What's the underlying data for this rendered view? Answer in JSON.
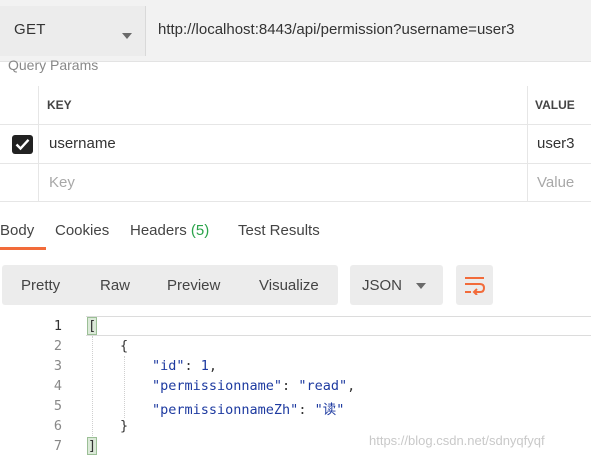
{
  "request": {
    "method": "GET",
    "url": "http://localhost:8443/api/permission?username=user3"
  },
  "query_params": {
    "label": "Query Params",
    "headers": {
      "key": "KEY",
      "value": "VALUE"
    },
    "rows": [
      {
        "checked": true,
        "key": "username",
        "value": "user3"
      }
    ],
    "placeholder": {
      "key": "Key",
      "value": "Value"
    }
  },
  "response_tabs": [
    {
      "label": "Body",
      "active": true
    },
    {
      "label": "Cookies"
    },
    {
      "label": "Headers",
      "count": "(5)"
    },
    {
      "label": "Test Results"
    }
  ],
  "view_modes": [
    "Pretty",
    "Raw",
    "Preview",
    "Visualize"
  ],
  "format": "JSON",
  "icons": {
    "wrap": "wrap-lines-icon",
    "caret": "chevron-down-icon",
    "check": "check-icon"
  },
  "colors": {
    "accent": "#f26b3a",
    "green": "#2aa34a"
  },
  "line_numbers": [
    "1",
    "2",
    "3",
    "4",
    "5",
    "6",
    "7"
  ],
  "body": {
    "l1": "[",
    "l2": "{",
    "k_id": "\"id\"",
    "v_id": "1",
    "k_name": "\"permissionname\"",
    "v_name": "\"read\"",
    "k_zh": "\"permissionnameZh\"",
    "v_zh": "\"读\"",
    "l6": "}",
    "l7": "]"
  },
  "watermark": "https://blog.csdn.net/sdnyqfyqf"
}
